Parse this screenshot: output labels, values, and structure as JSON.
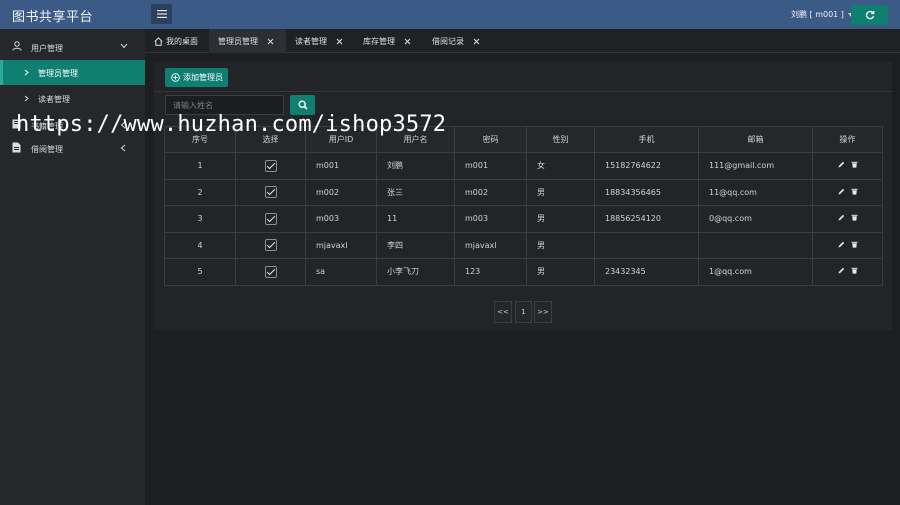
{
  "app": {
    "title": "图书共享平台"
  },
  "header": {
    "user": "刘鹏 [ m001 ]"
  },
  "sidebar": {
    "groups": [
      {
        "label": "用户管理"
      },
      {
        "label": "书籍管理"
      },
      {
        "label": "借阅管理"
      }
    ],
    "sub_items": [
      {
        "label": "管理员管理"
      },
      {
        "label": "读者管理"
      }
    ]
  },
  "tabs": [
    {
      "label": "我的桌面"
    },
    {
      "label": "管理员管理"
    },
    {
      "label": "读者管理"
    },
    {
      "label": "库存管理"
    },
    {
      "label": "借阅记录"
    }
  ],
  "toolbar": {
    "add_label": "添加管理员"
  },
  "search": {
    "placeholder": "请输入姓名"
  },
  "table": {
    "headers": [
      "序号",
      "选择",
      "用户ID",
      "用户名",
      "密码",
      "性别",
      "手机",
      "邮箱",
      "操作"
    ],
    "rows": [
      {
        "idx": "1",
        "checked": true,
        "uid": "m001",
        "name": "刘鹏",
        "pwd": "m001",
        "sex": "女",
        "phone": "15182764622",
        "email": "111@gmail.com"
      },
      {
        "idx": "2",
        "checked": true,
        "uid": "m002",
        "name": "张三",
        "pwd": "m002",
        "sex": "男",
        "phone": "18834356465",
        "email": "11@qq.com"
      },
      {
        "idx": "3",
        "checked": true,
        "uid": "m003",
        "name": "11",
        "pwd": "m003",
        "sex": "男",
        "phone": "18856254120",
        "email": "0@qq.com"
      },
      {
        "idx": "4",
        "checked": true,
        "uid": "mjavaxl",
        "name": "李四",
        "pwd": "mjavaxl",
        "sex": "男",
        "phone": "",
        "email": ""
      },
      {
        "idx": "5",
        "checked": true,
        "uid": "sa",
        "name": "小李飞刀",
        "pwd": "123",
        "sex": "男",
        "phone": "23432345",
        "email": "1@qq.com"
      }
    ]
  },
  "pagination": {
    "prev": "<<",
    "page": "1",
    "next": ">>"
  },
  "watermark": "https://www.huzhan.com/ishop3572",
  "icons": {
    "menu": "menu-icon",
    "refresh": "refresh-icon",
    "user": "user-icon",
    "book": "book-icon",
    "borrow": "document-icon",
    "home": "home-icon",
    "close": "close-icon",
    "add": "plus-circle-icon",
    "search": "search-icon",
    "edit": "pencil-icon",
    "delete": "trash-icon"
  },
  "colors": {
    "topbar": "#3b5a86",
    "accent": "#0e7f71",
    "background": "#1c1e20",
    "sidebar": "#25272a"
  }
}
